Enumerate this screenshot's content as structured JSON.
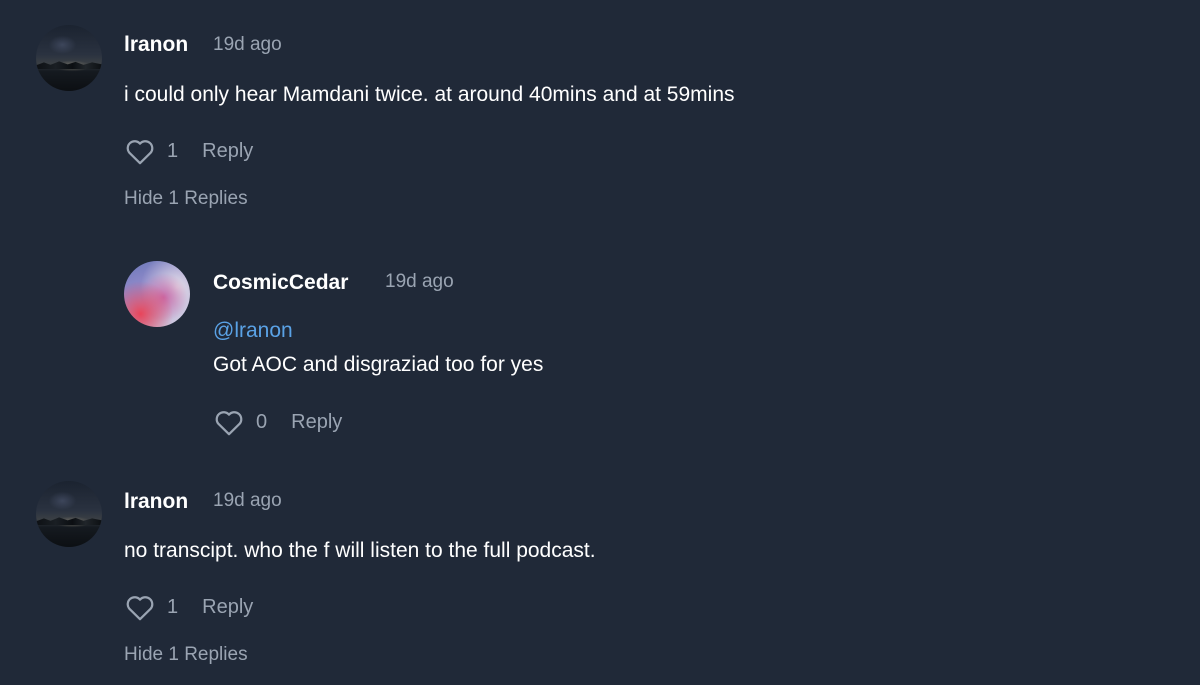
{
  "comments": [
    {
      "username": "lranon",
      "timestamp": "19d ago",
      "text": "i could only hear Mamdani twice. at around 40mins and at 59mins",
      "likes": "1",
      "reply_label": "Reply",
      "toggle_replies_label": "Hide 1 Replies",
      "avatar_icon": "night-landscape-avatar"
    },
    {
      "username": "CosmicCedar",
      "timestamp": "19d ago",
      "mention": "@lranon",
      "text": "Got AOC and disgraziad too for yes",
      "likes": "0",
      "reply_label": "Reply",
      "avatar_icon": "gradient-avatar"
    },
    {
      "username": "lranon",
      "timestamp": "19d ago",
      "text": "no transcipt. who the f will listen to the full podcast.",
      "likes": "1",
      "reply_label": "Reply",
      "toggle_replies_label": "Hide 1 Replies",
      "avatar_icon": "night-landscape-avatar"
    }
  ],
  "colors": {
    "background": "#202938",
    "text": "#ffffff",
    "muted": "#9aa4b2",
    "mention": "#5aa2e6"
  }
}
